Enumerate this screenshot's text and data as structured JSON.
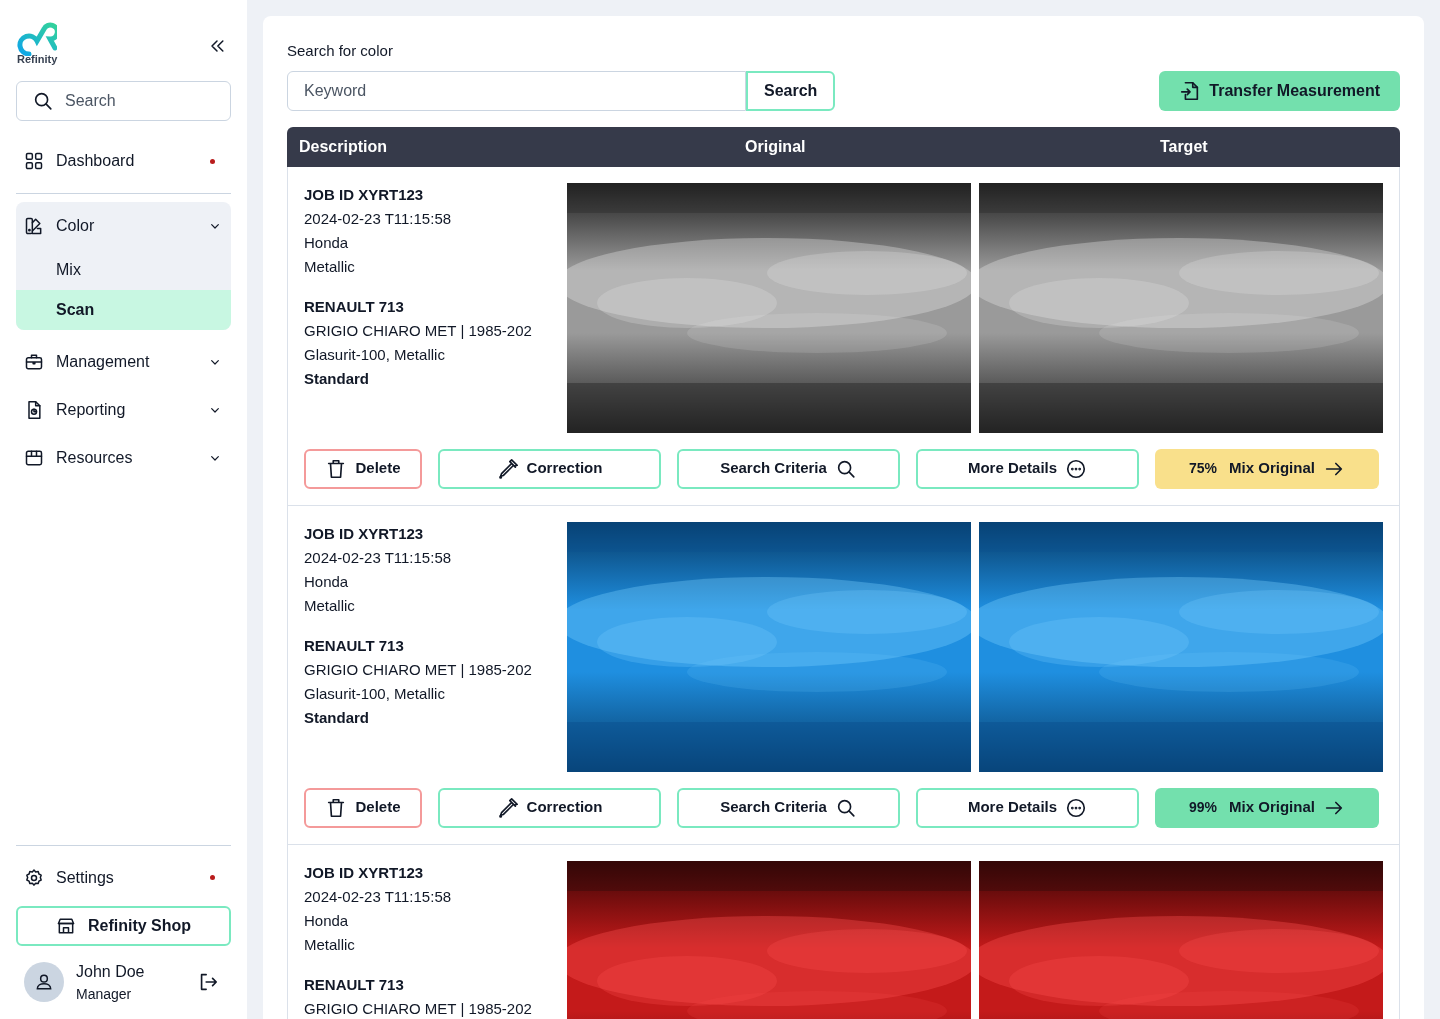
{
  "sidebar": {
    "logo": "Refinity",
    "search": {
      "placeholder": "Search"
    },
    "items": [
      {
        "label": "Dashboard",
        "notification": true
      },
      {
        "label": "Color",
        "notification": false,
        "expanded": true,
        "children": [
          {
            "label": "Mix",
            "selected": false
          },
          {
            "label": "Scan",
            "selected": true
          }
        ]
      },
      {
        "label": "Management",
        "notification": false,
        "expanded": false
      },
      {
        "label": "Reporting",
        "notification": false,
        "expanded": false
      },
      {
        "label": "Resources",
        "notification": false,
        "expanded": false
      }
    ],
    "settings": {
      "label": "Settings",
      "notification": true
    },
    "shop_button": "Refinity Shop",
    "user": {
      "name": "John Doe",
      "role": "Manager"
    }
  },
  "main": {
    "search_label": "Search for color",
    "search": {
      "placeholder": "Keyword"
    },
    "search_button": "Search",
    "transfer_button": "Transfer Measurement",
    "table": {
      "columns": [
        "Description",
        "Original",
        "Target"
      ],
      "rows": [
        {
          "job": "JOB ID XYRT123",
          "lines": [
            "2024-02-23 T11:15:58",
            "Honda",
            "Metallic"
          ],
          "model": "RENAULT 713",
          "details": [
            "GRIGIO CHIARO MET | 1985-202",
            "Glasurit-100, Metallic"
          ],
          "standard": "Standard",
          "original": {
            "kind": "picture"
          },
          "target": {
            "kind": "picture"
          },
          "buttons": [
            "Delete",
            "Correction",
            "Search Criteria",
            "More Details"
          ],
          "mix": {
            "percent": "75%",
            "label": "Mix Original",
            "color": "#f9e08b"
          }
        },
        {
          "job": "JOB ID XYRT123",
          "lines": [
            "2024-02-23 T11:15:58",
            "Honda",
            "Metallic"
          ],
          "model": "RENAULT 713",
          "details": [
            "GRIGIO CHIARO MET | 1985-202",
            "Glasurit-100, Metallic"
          ],
          "standard": "Standard",
          "original": {
            "kind": "picture"
          },
          "target": {
            "kind": "picture"
          },
          "buttons": [
            "Delete",
            "Correction",
            "Search Criteria",
            "More Details"
          ],
          "mix": {
            "percent": "99%",
            "label": "Mix Original",
            "color": "#73e0ad"
          }
        },
        {
          "job": "JOB ID XYRT123",
          "lines": [
            "2024-02-23 T11:15:58",
            "Honda",
            "Metallic"
          ],
          "model": "RENAULT 713",
          "details": [
            "GRIGIO CHIARO MET | 1985-202"
          ],
          "original": {
            "kind": "picture"
          },
          "target": {
            "kind": "picture"
          }
        }
      ]
    }
  }
}
